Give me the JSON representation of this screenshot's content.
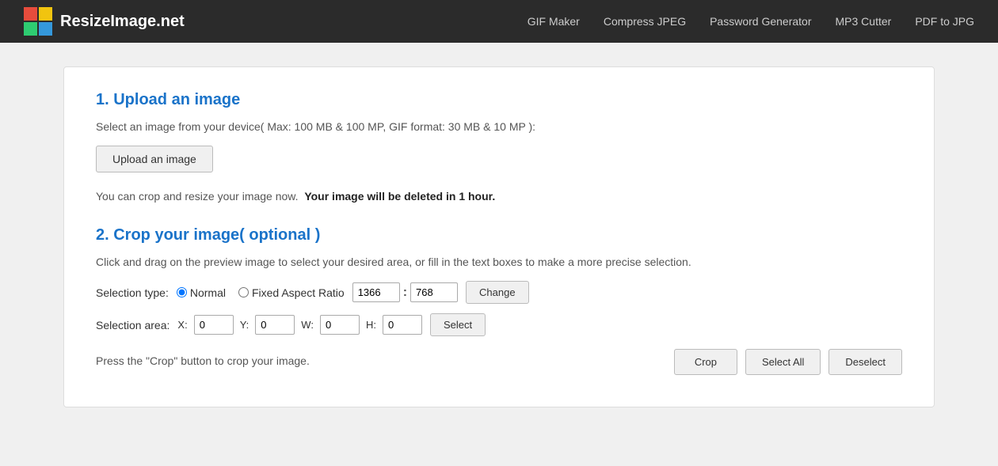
{
  "header": {
    "logo_text": "ResizeImage.net",
    "nav_items": [
      {
        "label": "GIF Maker",
        "id": "gif-maker"
      },
      {
        "label": "Compress JPEG",
        "id": "compress-jpeg"
      },
      {
        "label": "Password Generator",
        "id": "password-generator"
      },
      {
        "label": "MP3 Cutter",
        "id": "mp3-cutter"
      },
      {
        "label": "PDF to JPG",
        "id": "pdf-to-jpg"
      }
    ]
  },
  "section1": {
    "title": "1. Upload an image",
    "description": "Select an image from your device( Max: 100 MB & 100 MP, GIF format: 30 MB & 10 MP ):",
    "upload_button_label": "Upload an image",
    "delete_notice_plain": "You can crop and resize your image now.",
    "delete_notice_bold": "Your image will be deleted in 1 hour."
  },
  "section2": {
    "title": "2. Crop your image( optional )",
    "instruction": "Click and drag on the preview image to select your desired area, or fill in the text boxes to make a more precise selection.",
    "selection_type_label": "Selection type:",
    "radio_normal": "Normal",
    "radio_fixed": "Fixed Aspect Ratio",
    "ratio_width": "1366",
    "ratio_height": "768",
    "ratio_separator": ":",
    "change_button": "Change",
    "selection_area_label": "Selection area:",
    "x_label": "X:",
    "x_value": "0",
    "y_label": "Y:",
    "y_value": "0",
    "w_label": "W:",
    "w_value": "0",
    "h_label": "H:",
    "h_value": "0",
    "select_button": "Select",
    "press_note": "Press the \"Crop\" button to crop your image.",
    "crop_button": "Crop",
    "select_all_button": "Select All",
    "deselect_button": "Deselect"
  },
  "colors": {
    "accent": "#1a73c9",
    "nav_bg": "#2b2b2b",
    "body_bg": "#f0f0f0"
  }
}
